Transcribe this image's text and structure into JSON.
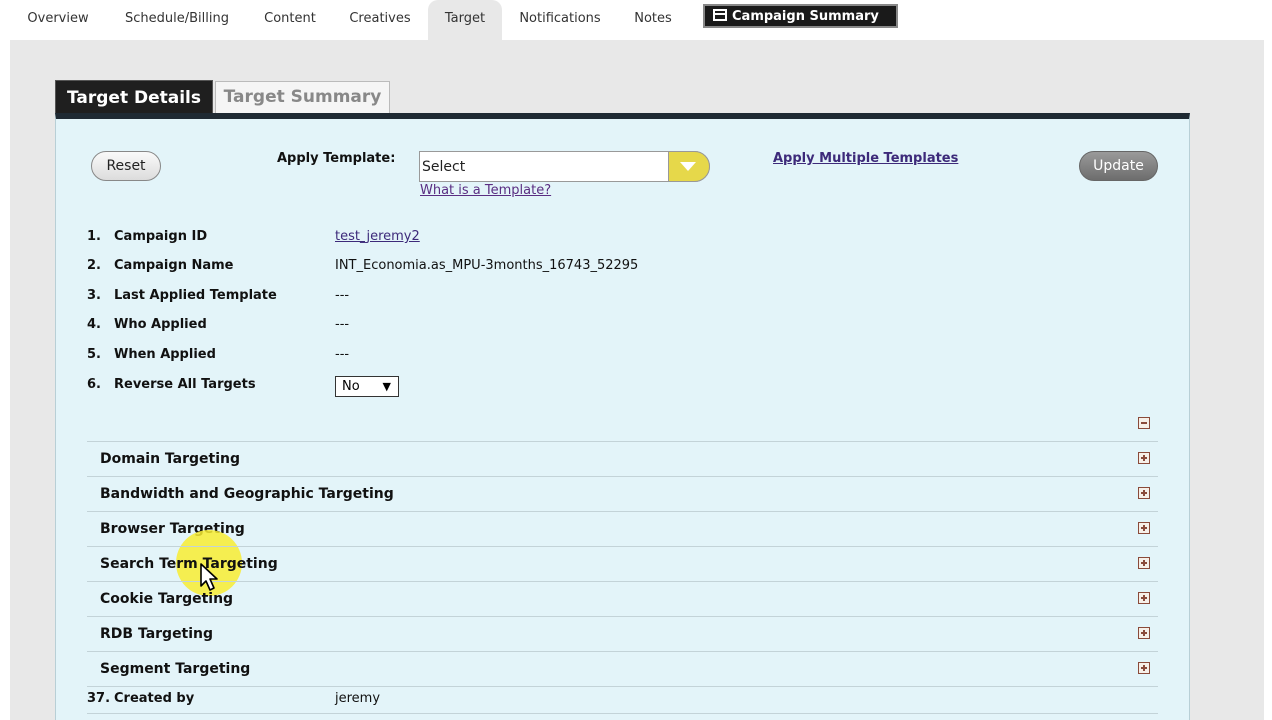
{
  "nav": {
    "tabs": [
      {
        "label": "Overview"
      },
      {
        "label": "Schedule/Billing"
      },
      {
        "label": "Content"
      },
      {
        "label": "Creatives"
      },
      {
        "label": "Target"
      },
      {
        "label": "Notifications"
      },
      {
        "label": "Notes"
      }
    ],
    "active_tab": "Target",
    "summary_button": "Campaign Summary"
  },
  "subtabs": {
    "details": "Target Details",
    "summary": "Target Summary",
    "active": "Target Details"
  },
  "toolbar": {
    "reset": "Reset",
    "apply_template_label": "Apply Template:",
    "template_value": "Select",
    "what_is_template": "What is a Template?",
    "apply_multiple": "Apply Multiple Templates",
    "update": "Update"
  },
  "info": [
    {
      "num": "1.",
      "label": "Campaign ID",
      "value": "test_jeremy2"
    },
    {
      "num": "2.",
      "label": "Campaign Name",
      "value": "INT_Economia.as_MPU-3months_16743_52295"
    },
    {
      "num": "3.",
      "label": "Last Applied Template",
      "value": "---"
    },
    {
      "num": "4.",
      "label": "Who Applied",
      "value": "---"
    },
    {
      "num": "5.",
      "label": "When Applied",
      "value": "---"
    },
    {
      "num": "6.",
      "label": "Reverse All Targets",
      "value": "No"
    }
  ],
  "sections": [
    {
      "label": "Domain Targeting"
    },
    {
      "label": "Bandwidth and Geographic Targeting"
    },
    {
      "label": "Browser Targeting"
    },
    {
      "label": "Search Term Targeting"
    },
    {
      "label": "Cookie Targeting"
    },
    {
      "label": "RDB Targeting"
    },
    {
      "label": "Segment Targeting"
    }
  ],
  "created": {
    "num": "37.",
    "label": "Created by",
    "value": "jeremy"
  },
  "colors": {
    "panel": "#e3f4f9",
    "header_bar": "#1f2a33",
    "select_arrow": "#e6d84a",
    "link": "#3d2a7a",
    "cursor_highlight": "#f8ec32"
  }
}
